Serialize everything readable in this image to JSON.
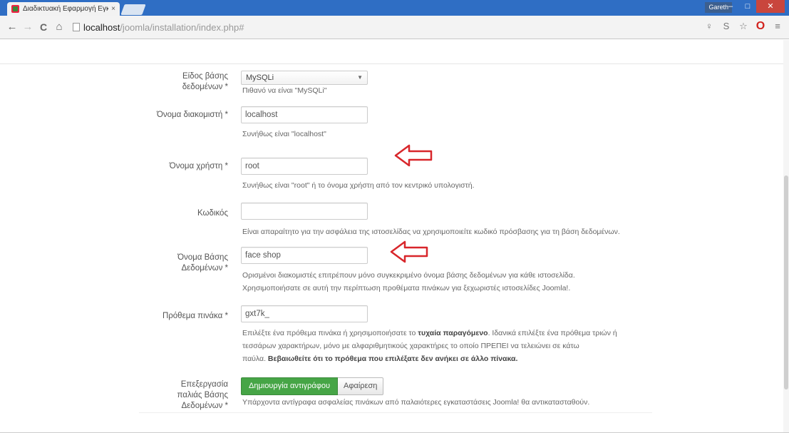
{
  "browser": {
    "tab_title": "Διαδικτυακή Εφαρμογή Εγκ",
    "tab_close": "×",
    "user_badge": "Gareth",
    "win_minimize": "–",
    "win_maximize": "□",
    "win_close": "✕",
    "back": "←",
    "forward": "→",
    "reload": "C",
    "home": "⌂",
    "url_host": "localhost",
    "url_path": "/joomla/installation/index.php#",
    "ext1": "♀",
    "ext2": "S",
    "star": "☆",
    "opera": "O",
    "menu": "≡"
  },
  "form": {
    "db_type": {
      "label": "Είδος βάσης δεδομένων *",
      "value": "MySQLi",
      "caret": "▼",
      "help": "Πιθανό να είναι \"MySQLi\""
    },
    "host": {
      "label": "Όνομα διακομιστή *",
      "value": "localhost",
      "help": "Συνήθως είναι \"localhost\""
    },
    "username": {
      "label": "Όνομα χρήστη *",
      "value": "root",
      "help": "Συνήθως είναι \"root\" ή το όνομα χρήστη από τον κεντρικό υπολογιστή."
    },
    "password": {
      "label": "Κωδικός",
      "value": "",
      "help": "Είναι απαραίτητο για την ασφάλεια της ιστοσελίδας να χρησιμοποιείτε κωδικό πρόσβασης για τη βάση δεδομένων."
    },
    "db_name": {
      "label": "Όνομα Βάσης Δεδομένων *",
      "value": "face shop",
      "help_line1": "Ορισμένοι διακομιστές επιτρέπουν μόνο συγκεκριμένο όνομα βάσης δεδομένων για κάθε ιστοσελίδα.",
      "help_line2": "Χρησιμοποιήσατε σε αυτή την περίπτωση προθέματα πινάκων για ξεχωριστές ιστοσελίδες Joomla!."
    },
    "prefix": {
      "label": "Πρόθεμα πινάκα *",
      "value": "gxt7k_",
      "help_line1_a": "Επιλέξτε ένα πρόθεμα πινάκα ή χρησιμοποιήσατε το ",
      "help_line1_b": "τυχαία παραγόμενο",
      "help_line1_c": ". Ιδανικά επιλέξτε ένα πρόθεμα τριών ή",
      "help_line2": "τεσσάρων χαρακτήρων, μόνο με αλφαριθμητικούς χαρακτήρες το οποίο ΠΡΕΠΕΙ να τελειώνει σε κάτω",
      "help_line3_a": "παύλα. ",
      "help_line3_b": "Βεβαιωθείτε ότι το πρόθεμα που επιλέξατε δεν ανήκει σε άλλο πίνακα."
    },
    "old_db": {
      "label": "Επεξεργασία παλιάς Βάσης Δεδομένων *",
      "btn_backup": "Δημιουργία αντιγράφου",
      "btn_remove": "Αφαίρεση",
      "help": "Υπάρχοντα αντίγραφα ασφαλείας πινάκων από παλαιότερες εγκαταστάσεις Joomla! θα αντικατασταθούν."
    }
  },
  "colors": {
    "arrow": "#d8262b",
    "green": "#46a546"
  }
}
